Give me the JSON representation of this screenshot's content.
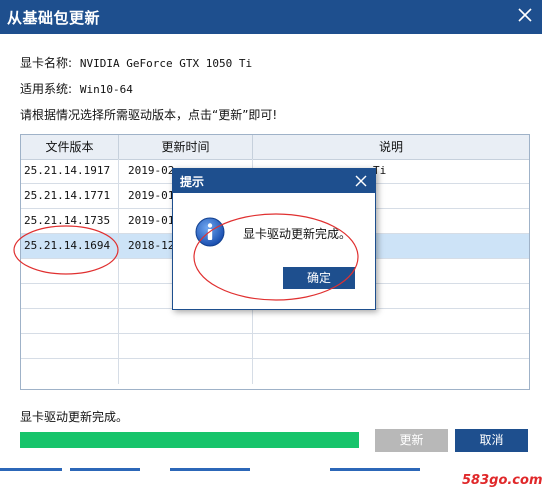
{
  "window": {
    "title": "从基础包更新",
    "close_icon": "close-icon"
  },
  "info": {
    "gpu_label": "显卡名称:",
    "gpu_value": "NVIDIA GeForce GTX 1050 Ti",
    "os_label": "适用系统:",
    "os_value": "Win10-64",
    "instruction": "请根据情况选择所需驱动版本，点击“更新”即可!"
  },
  "table": {
    "headers": [
      "文件版本",
      "更新时间",
      "说明"
    ],
    "rows": [
      {
        "version": "25.21.14.1917",
        "date": "2019-02",
        "note": "Ti"
      },
      {
        "version": "25.21.14.1771",
        "date": "2019-01",
        "note": ""
      },
      {
        "version": "25.21.14.1735",
        "date": "2019-01",
        "note": ""
      },
      {
        "version": "25.21.14.1694",
        "date": "2018-12",
        "note": ""
      }
    ],
    "selected_row": 3
  },
  "status": {
    "text": "显卡驱动更新完成。",
    "progress_percent": 100,
    "progress_color": "#17c46b"
  },
  "buttons": {
    "update_label": "更新",
    "cancel_label": "取消"
  },
  "dialog": {
    "title": "提示",
    "icon": "info-icon",
    "message": "显卡驱动更新完成。",
    "ok_label": "确定"
  },
  "colors": {
    "title_bar": "#1e4f8e",
    "selected_row": "#cde3f7",
    "annotation_circle": "#e03030"
  },
  "watermark": {
    "text": "583go.com"
  }
}
